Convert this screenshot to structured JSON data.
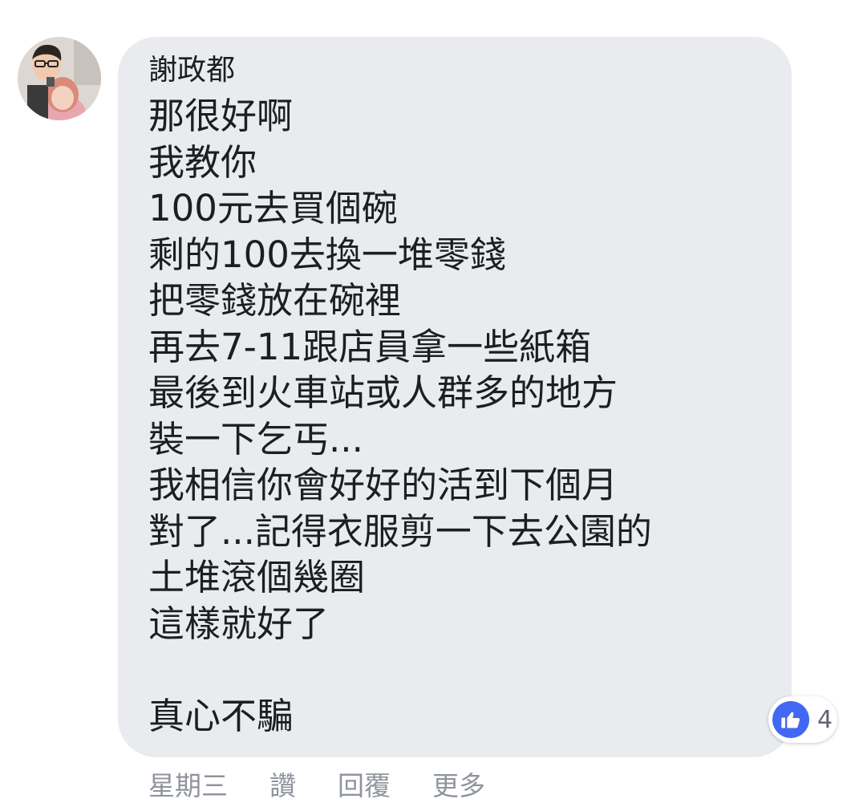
{
  "comment": {
    "author": "謝政都",
    "lines": [
      "那很好啊",
      "我教你",
      "100元去買個碗",
      "剩的100去換一堆零錢",
      "把零錢放在碗裡",
      "再去7-11跟店員拿一些紙箱",
      "最後到火車站或人群多的地方",
      "裝一下乞丐...",
      "我相信你會好好的活到下個月",
      "對了...記得衣服剪一下去公園的",
      "土堆滾個幾圈",
      "這樣就好了",
      "",
      "真心不騙"
    ],
    "reaction": {
      "icon": "thumbs-up-icon",
      "count": "4",
      "color": "#4267f2"
    }
  },
  "actions": {
    "time": "星期三",
    "like": "讚",
    "reply": "回覆",
    "more": "更多"
  },
  "colors": {
    "bubble": "#e9ebee",
    "text": "#1c1e21",
    "meta": "#90949c"
  }
}
